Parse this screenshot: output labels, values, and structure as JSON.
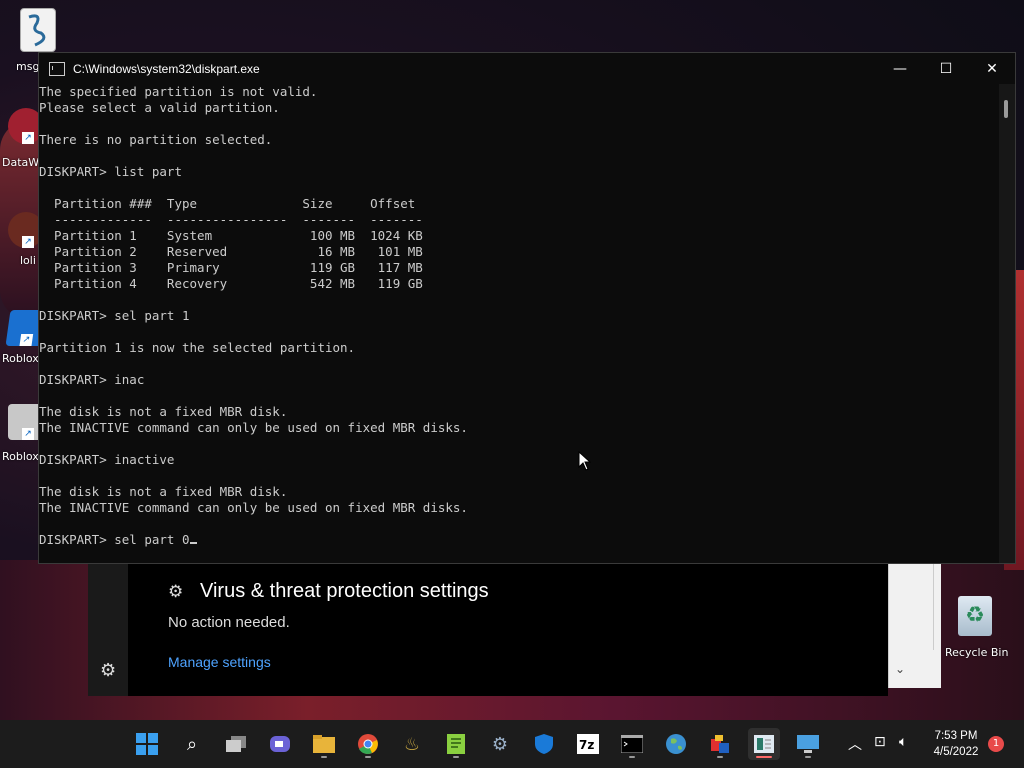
{
  "desktop": {
    "icons": [
      {
        "label": "msg",
        "icon": "notepad-file-icon"
      },
      {
        "label": "DataW",
        "icon": "datawrapper-icon"
      },
      {
        "label": "loli",
        "icon": "app-icon"
      },
      {
        "label": "Roblox",
        "icon": "roblox-icon"
      },
      {
        "label": "Roblox",
        "icon": "roblox-studio-icon"
      }
    ],
    "recycle_bin": {
      "label": "Recycle Bin"
    }
  },
  "console": {
    "title": "C:\\Windows\\system32\\diskpart.exe",
    "lines": [
      "The specified partition is not valid.",
      "Please select a valid partition.",
      "",
      "There is no partition selected.",
      "",
      "DISKPART> list part",
      "",
      "  Partition ###  Type              Size     Offset",
      "  -------------  ----------------  -------  -------",
      "  Partition 1    System             100 MB  1024 KB",
      "  Partition 2    Reserved            16 MB   101 MB",
      "  Partition 3    Primary            119 GB   117 MB",
      "  Partition 4    Recovery           542 MB   119 GB",
      "",
      "DISKPART> sel part 1",
      "",
      "Partition 1 is now the selected partition.",
      "",
      "DISKPART> inac",
      "",
      "The disk is not a fixed MBR disk.",
      "The INACTIVE command can only be used on fixed MBR disks.",
      "",
      "DISKPART> inactive",
      "",
      "The disk is not a fixed MBR disk.",
      "The INACTIVE command can only be used on fixed MBR disks.",
      ""
    ],
    "prompt_line": "DISKPART> sel part 0"
  },
  "toast": {
    "heading": "Virus & threat protection settings",
    "status": "No action needed.",
    "link": "Manage settings"
  },
  "taskbar": {
    "time": "7:53 PM",
    "date": "4/5/2022",
    "notification_count": "1",
    "apps": [
      "start-icon",
      "search-icon",
      "task-view-icon",
      "chat-icon",
      "file-explorer-icon",
      "chrome-icon",
      "inkscape-icon",
      "notepad-plus-icon",
      "settings-icon",
      "windows-security-icon",
      "7zip-icon",
      "terminal-icon",
      "earth-icon",
      "paint-icon",
      "notepad-active-icon",
      "remote-desktop-icon"
    ]
  }
}
